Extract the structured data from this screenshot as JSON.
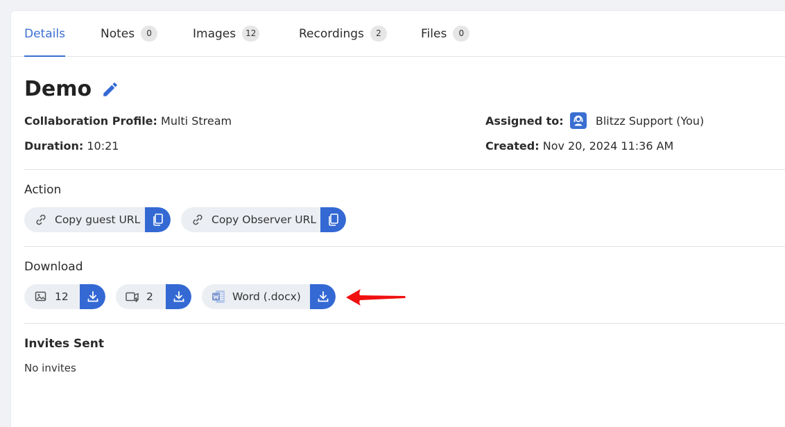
{
  "tabs": [
    {
      "label": "Details",
      "count": null
    },
    {
      "label": "Notes",
      "count": "0"
    },
    {
      "label": "Images",
      "count": "12"
    },
    {
      "label": "Recordings",
      "count": "2"
    },
    {
      "label": "Files",
      "count": "0"
    }
  ],
  "session": {
    "title": "Demo",
    "profile_label": "Collaboration Profile:",
    "profile_value": "Multi Stream",
    "duration_label": "Duration:",
    "duration_value": "10:21",
    "assigned_label": "Assigned to:",
    "assigned_value": "Blitzz Support (You)",
    "created_label": "Created:",
    "created_value": "Nov 20, 2024 11:36 AM"
  },
  "action": {
    "heading": "Action",
    "copy_guest": "Copy guest URL",
    "copy_observer": "Copy Observer URL"
  },
  "download": {
    "heading": "Download",
    "images_count": "12",
    "recordings_count": "2",
    "word_label": "Word (.docx)"
  },
  "invites": {
    "heading": "Invites Sent",
    "empty_text": "No invites"
  },
  "colors": {
    "accent": "#3469d4",
    "tab_active": "#3a6fd1",
    "annotation_arrow": "#f01010"
  }
}
